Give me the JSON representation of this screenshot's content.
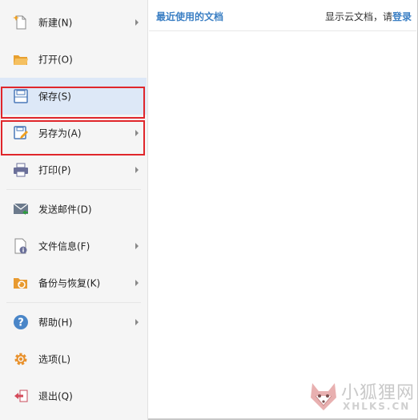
{
  "menu": {
    "items": [
      {
        "label": "新建(N)",
        "icon": "new-document-icon",
        "has_submenu": true
      },
      {
        "label": "打开(O)",
        "icon": "open-folder-icon",
        "has_submenu": false
      },
      {
        "label": "保存(S)",
        "icon": "save-icon",
        "has_submenu": false,
        "selected": true,
        "annotated": true
      },
      {
        "label": "另存为(A)",
        "icon": "save-as-icon",
        "has_submenu": true,
        "annotated": true
      },
      {
        "label": "打印(P)",
        "icon": "printer-icon",
        "has_submenu": true
      },
      {
        "label": "发送邮件(D)",
        "icon": "send-mail-icon",
        "has_submenu": false
      },
      {
        "label": "文件信息(F)",
        "icon": "file-info-icon",
        "has_submenu": true
      },
      {
        "label": "备份与恢复(K)",
        "icon": "backup-restore-icon",
        "has_submenu": true
      },
      {
        "label": "帮助(H)",
        "icon": "help-icon",
        "has_submenu": true
      },
      {
        "label": "选项(L)",
        "icon": "gear-icon",
        "has_submenu": false
      },
      {
        "label": "退出(Q)",
        "icon": "exit-icon",
        "has_submenu": false
      }
    ]
  },
  "recent": {
    "title": "最近使用的文档",
    "cloud_prompt": "显示云文档，请",
    "login_label": "登录"
  },
  "watermark": {
    "text_cn": "小狐狸网",
    "text_en": "XHLKS.CN"
  },
  "colors": {
    "accent": "#3b7fc4",
    "selected_bg": "#dde8f7",
    "annotation_red": "#e0262b",
    "sidebar_bg": "#f5f5f5"
  }
}
